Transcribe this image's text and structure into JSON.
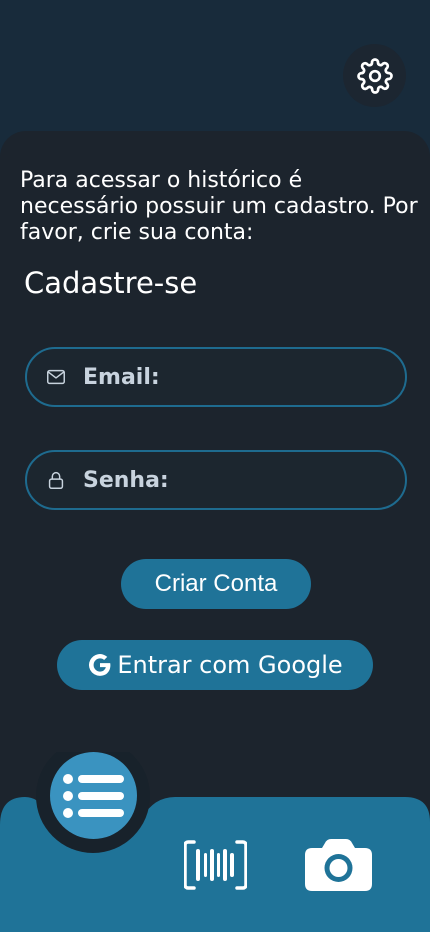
{
  "intro_text": "Para acessar o histórico é necessário possuir um cadastro. Por favor, crie sua conta:",
  "title": "Cadastre-se",
  "form": {
    "email_label": "Email:",
    "password_label": "Senha:"
  },
  "buttons": {
    "create_account": "Criar Conta",
    "google_login": "Entrar com Google"
  },
  "icons": {
    "settings": "gear-icon",
    "email": "envelope-icon",
    "password": "lock-icon",
    "google": "google-g-icon",
    "menu": "list-icon",
    "barcode": "barcode-icon",
    "camera": "camera-icon"
  },
  "colors": {
    "accent": "#1f7398",
    "fab": "#3a93c0",
    "panel": "#1c242d",
    "nav": "#1f7398"
  }
}
